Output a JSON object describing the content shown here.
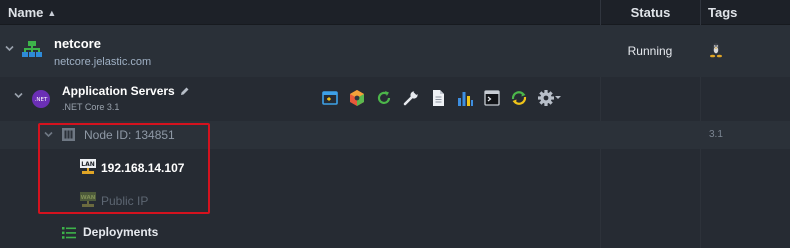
{
  "header": {
    "name": "Name",
    "sort_indicator": "▲",
    "status": "Status",
    "tags": "Tags"
  },
  "environment": {
    "name": "netcore",
    "domain": "netcore.jelastic.com",
    "status": "Running",
    "icon": "network-topology-icon",
    "tag_icon": "tux-linux-icon",
    "accent_color": "#3db34a"
  },
  "app_server": {
    "name": "Application Servers",
    "subtitle": ".NET Core 3.1",
    "badge_text": ".NET",
    "badge_color": "#6b2fb5",
    "tools": [
      "open-in-browser-icon",
      "add-ons-icon",
      "restart-icon",
      "config-icon",
      "log-icon",
      "statistics-icon",
      "web-ssh-icon",
      "redeploy-icon",
      "settings-icon"
    ]
  },
  "node": {
    "label": "Node ID: 134851",
    "tag": "3.1",
    "ips": [
      {
        "label": "192.168.14.107",
        "type": "LAN"
      },
      {
        "label": "Public IP",
        "type": "WAN"
      }
    ]
  },
  "deployments": {
    "label": "Deployments"
  },
  "highlight_color": "#d4121e"
}
